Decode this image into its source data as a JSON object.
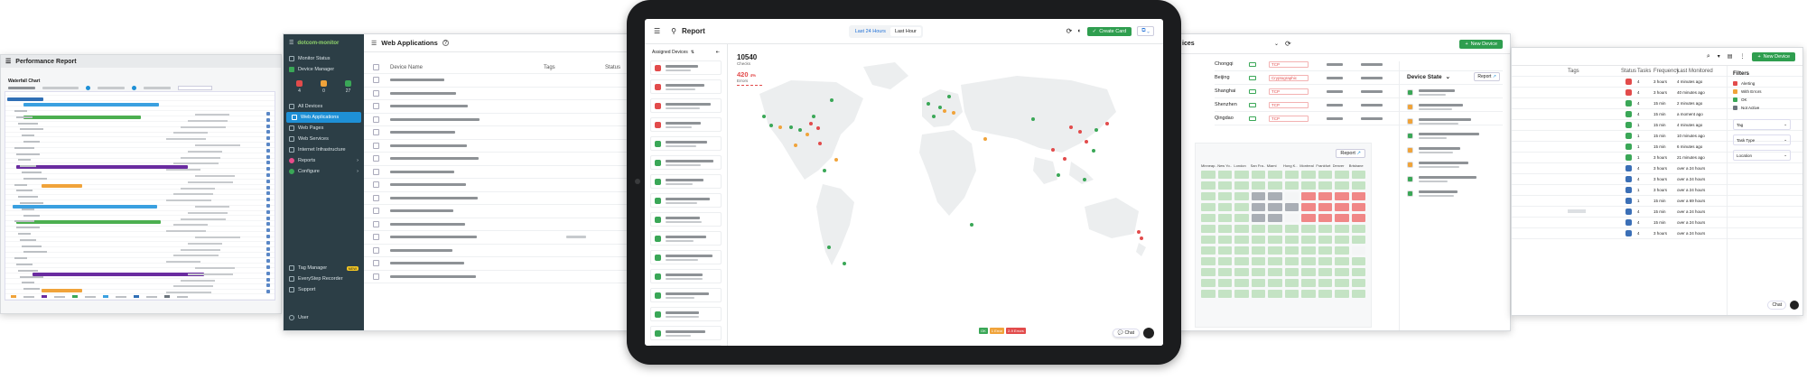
{
  "panel_performance": {
    "title": "Performance Report",
    "subtitle": "Waterfall Chart"
  },
  "panel_webapps": {
    "brand": "dotcom-monitor",
    "sidebar": [
      {
        "label": "Monitor Status",
        "icon": "gauge-icon"
      },
      {
        "label": "Device Manager",
        "icon": "grid-icon"
      },
      {
        "label": "All Devices",
        "icon": "list-icon"
      },
      {
        "label": "Web Applications",
        "icon": "browser-icon",
        "active": true
      },
      {
        "label": "Web Pages",
        "icon": "page-icon"
      },
      {
        "label": "Web Services",
        "icon": "cloud-icon"
      },
      {
        "label": "Internet Infrastructure",
        "icon": "network-icon"
      },
      {
        "label": "Reports",
        "icon": "report-icon"
      },
      {
        "label": "Configure",
        "icon": "gear-icon"
      }
    ],
    "sidebar_bottom": [
      {
        "label": "Tag Manager",
        "badge": "NEW"
      },
      {
        "label": "EveryStep Recorder"
      },
      {
        "label": "Support"
      }
    ],
    "user_label": "User",
    "status_counts": [
      "4",
      "0",
      "27"
    ],
    "page_title": "Web Applications",
    "columns": [
      "Device Name",
      "Tags",
      "Status"
    ]
  },
  "tablet_report": {
    "title": "Report",
    "time_ranges": [
      "Last 24 Hours",
      "Last Hour"
    ],
    "create_card_label": "Create Card",
    "assigned_label": "Assigned Devices",
    "checks_count": "10540",
    "checks_label": "Checks",
    "errors_count": "420",
    "errors_unit": "4%",
    "errors_label": "Errors",
    "chat_label": "Chat",
    "legend": [
      "OK",
      "1 Error",
      "2-9 Errors"
    ],
    "colors": {
      "ok": "#3aa757",
      "warn": "#f0a33a",
      "error": "#e24b4b",
      "accent": "#2f9e4f"
    }
  },
  "panel_devices": {
    "title": "ices",
    "new_device_label": "New Device",
    "cities": [
      {
        "name": "Chongqi",
        "tag": "TCP"
      },
      {
        "name": "Beijing",
        "tag": "Cryptographic"
      },
      {
        "name": "Shanghai",
        "tag": "TCP"
      },
      {
        "name": "Shenzhen",
        "tag": "TCP"
      },
      {
        "name": "Qingdao",
        "tag": "TCP"
      }
    ],
    "device_state_label": "Device State",
    "report_label": "Report",
    "heatmap_cols": [
      "Minneap..",
      "New Yo..",
      "London",
      "San Fra..",
      "Miami",
      "Hong K..",
      "Montreal",
      "Frankfurt",
      "Denver",
      "Brisbane"
    ]
  },
  "panel_list": {
    "new_device_label": "New Device",
    "columns": [
      "Tags",
      "Status",
      "Tasks",
      "Frequency",
      "Last Monitored"
    ],
    "rows": [
      {
        "tasks": "4",
        "freq": "3 hours",
        "last": "4 minutes ago",
        "status": "r"
      },
      {
        "tasks": "4",
        "freq": "3 hours",
        "last": "40 minutes ago",
        "status": "r"
      },
      {
        "tasks": "4",
        "freq": "15 min",
        "last": "2 minutes ago",
        "status": "g"
      },
      {
        "tasks": "4",
        "freq": "15 min",
        "last": "a moment ago",
        "status": "g"
      },
      {
        "tasks": "1",
        "freq": "15 min",
        "last": "4 minutes ago",
        "status": "g"
      },
      {
        "tasks": "1",
        "freq": "15 min",
        "last": "10 minutes ago",
        "status": "g"
      },
      {
        "tasks": "1",
        "freq": "15 min",
        "last": "6 minutes ago",
        "status": "g"
      },
      {
        "tasks": "1",
        "freq": "3 hours",
        "last": "21 minutes ago",
        "status": "g"
      },
      {
        "tasks": "4",
        "freq": "3 hours",
        "last": "over a 24 hours",
        "status": "b"
      },
      {
        "tasks": "4",
        "freq": "3 hours",
        "last": "over a 24 hours",
        "status": "b"
      },
      {
        "tasks": "1",
        "freq": "3 hours",
        "last": "over a 24 hours",
        "status": "b"
      },
      {
        "tasks": "1",
        "freq": "15 min",
        "last": "over a 69 hours",
        "status": "b"
      },
      {
        "tasks": "4",
        "freq": "15 min",
        "last": "over a 24 hours",
        "status": "b"
      },
      {
        "tasks": "4",
        "freq": "15 min",
        "last": "over a 24 hours",
        "status": "b"
      },
      {
        "tasks": "4",
        "freq": "3 hours",
        "last": "over a 24 hours",
        "status": "b"
      }
    ],
    "filters_label": "Filters",
    "filters": [
      "Alerting",
      "With Errors",
      "OK",
      "Not Active"
    ],
    "selects": [
      "Tag",
      "Task Type",
      "Location"
    ],
    "chat_label": "Chat"
  }
}
